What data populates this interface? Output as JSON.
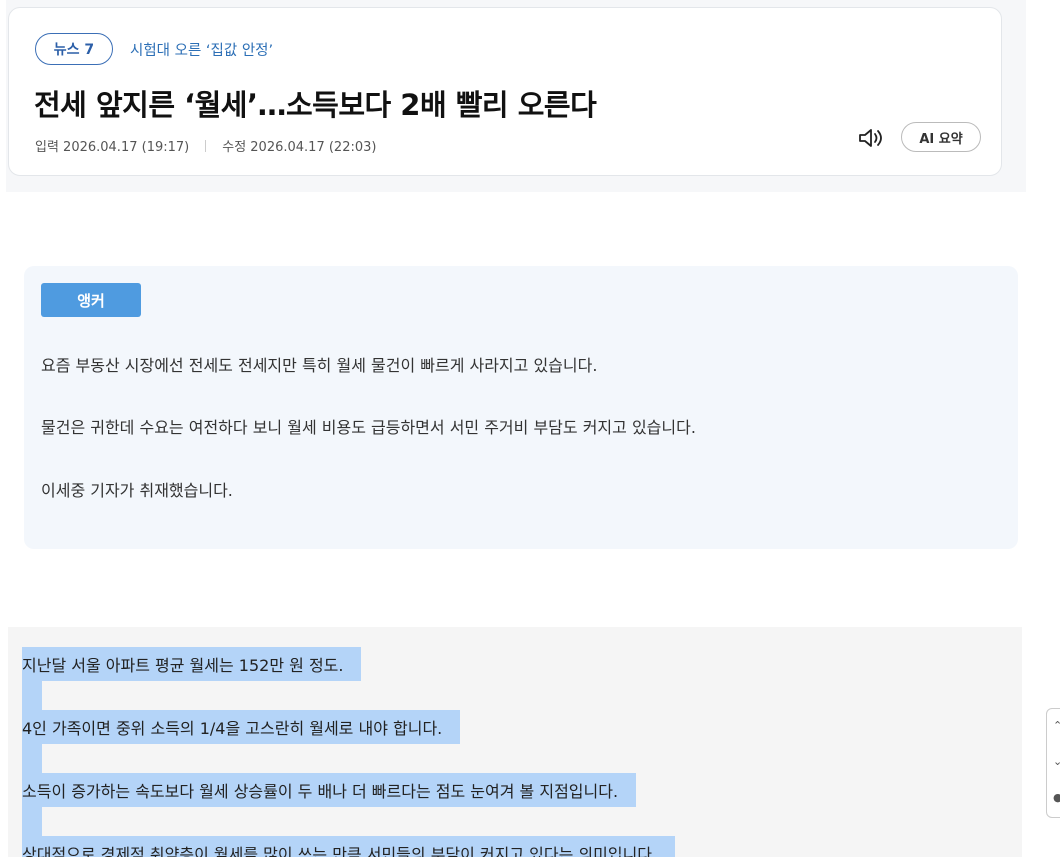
{
  "header": {
    "program": "뉴스 7",
    "kicker": "시험대 오른 ‘집값 안정’",
    "headline": "전세 앞지른 ‘월세’…소득보다 2배 빨리 오른다",
    "input_time": "입력 2026.04.17 (19:17)",
    "edit_time": "수정 2026.04.17 (22:03)",
    "speaker_icon": "speaker-icon",
    "ai_summary_label": "AI 요약"
  },
  "anchor": {
    "tag": "앵커",
    "lines": [
      "요즘 부동산 시장에선 전세도 전세지만 특히 월세 물건이 빠르게 사라지고 있습니다.",
      "물건은 귀한데 수요는 여전하다 보니 월세 비용도 급등하면서 서민 주거비 부담도 커지고 있습니다.",
      "이세중 기자가 취재했습니다."
    ]
  },
  "body": {
    "lines": [
      "지난달 서울 아파트 평균 월세는 152만 원 정도.",
      "4인 가족이면 중위 소득의 1/4을 고스란히 월세로 내야 합니다.",
      "소득이 증가하는 속도보다 월세 상승률이 두 배나 더 빠르다는 점도 눈여겨 볼 지점입니다.",
      "상대적으로 경제적 취약층이 월세를 많이 쓰는 만큼 서민들의 부담이 커지고 있다는 의미입니다."
    ]
  },
  "colors": {
    "accent_blue": "#4f9be0",
    "selection": "#b4d4f8",
    "anchor_bg": "#f3f7fc"
  }
}
